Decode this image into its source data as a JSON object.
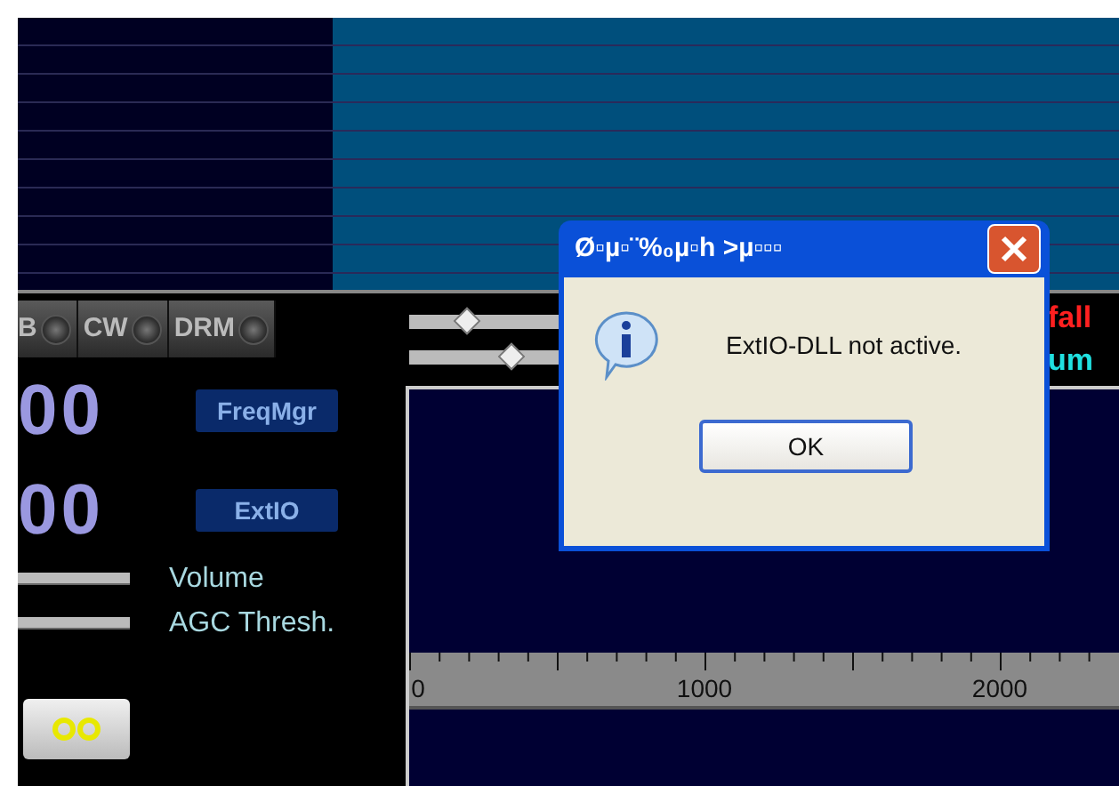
{
  "modes": [
    {
      "label": "B"
    },
    {
      "label": "CW"
    },
    {
      "label": "DRM"
    }
  ],
  "frequency_displays": [
    {
      "digits": "00"
    },
    {
      "digits": "00"
    }
  ],
  "buttons": [
    {
      "label": "FreqMgr"
    },
    {
      "label": "ExtIO"
    }
  ],
  "level_sliders": [
    {
      "label": "Volume"
    },
    {
      "label": "AGC Thresh."
    }
  ],
  "top_sliders": [
    {
      "level": 0.35
    },
    {
      "level": 0.63
    }
  ],
  "status_labels": [
    {
      "text": "fall",
      "color": "#ff2020"
    },
    {
      "text": "um",
      "color": "#20e0e0"
    }
  ],
  "scale": {
    "labels": [
      {
        "text": "0"
      },
      {
        "text": "1000"
      },
      {
        "text": "2000"
      }
    ]
  },
  "dialog": {
    "title": "Ø▫µ▫¨%₀µ▫h >µ▫▫▫",
    "message": "ExtIO-DLL not active.",
    "ok": "OK"
  }
}
